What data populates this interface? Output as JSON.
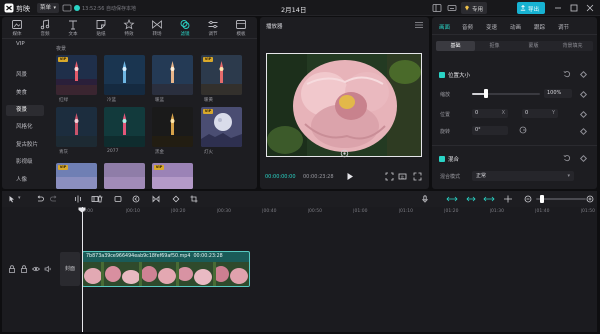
{
  "titlebar": {
    "app_name": "剪映",
    "menu_label": "菜单",
    "autosave_text": "13:52:56 自动保存本地",
    "project_title": "2月14日",
    "pro_label": "专用",
    "export_label": "导出"
  },
  "media_toolbar": {
    "items": [
      {
        "label": "媒体",
        "icon": "media-icon"
      },
      {
        "label": "音频",
        "icon": "audio-icon"
      },
      {
        "label": "文本",
        "icon": "text-icon"
      },
      {
        "label": "贴纸",
        "icon": "sticker-icon"
      },
      {
        "label": "特效",
        "icon": "effects-icon"
      },
      {
        "label": "转场",
        "icon": "transition-icon"
      },
      {
        "label": "滤镜",
        "icon": "filter-icon"
      },
      {
        "label": "调节",
        "icon": "adjust-icon"
      },
      {
        "label": "模板",
        "icon": "template-icon"
      }
    ],
    "active_index": 6
  },
  "categories": {
    "items": [
      "VIP",
      "风景",
      "美食",
      "夜景",
      "风格化",
      "复古胶片",
      "影视级",
      "人像",
      "基础"
    ],
    "active_index": 3
  },
  "filter_section_heading": "夜景",
  "filters": [
    {
      "name": "红绿",
      "vip": true
    },
    {
      "name": "冷蓝",
      "vip": false
    },
    {
      "name": "暖蓝",
      "vip": false
    },
    {
      "name": "暖黄",
      "vip": true
    },
    {
      "name": "青灰",
      "vip": false
    },
    {
      "name": "2077",
      "vip": false
    },
    {
      "name": "黑金",
      "vip": false
    },
    {
      "name": "灯火",
      "vip": false
    },
    {
      "name": "",
      "vip": true
    },
    {
      "name": "",
      "vip": false
    },
    {
      "name": "",
      "vip": true
    }
  ],
  "player": {
    "title": "播放器",
    "timecode_current": "00:00:00:00",
    "timecode_total": "00:00:23:28"
  },
  "inspector": {
    "tabs": [
      "画面",
      "音频",
      "变速",
      "动画",
      "跟踪",
      "调节"
    ],
    "active_tab": 0,
    "subtabs": [
      "基础",
      "抠像",
      "蒙版",
      "背景填充"
    ],
    "active_subtab": 0,
    "position_section": {
      "title": "位置大小",
      "scale_label": "缩放",
      "scale_value": "100%",
      "scale_fraction": 0.21,
      "position_label": "位置",
      "pos_x": "0",
      "pos_x_unit": "X",
      "pos_y": "0",
      "pos_y_unit": "Y",
      "rotate_label": "旋转",
      "rotate_value": "0°"
    },
    "blend_section": {
      "title": "混合",
      "mode_label": "混合模式",
      "mode_value": "正常"
    }
  },
  "timeline": {
    "ruler_labels": [
      "00:00",
      "|00:10",
      "|00:20",
      "|00:30",
      "|00:40",
      "|00:50",
      "|01:00",
      "|01:10",
      "|01:20",
      "|01:30",
      "|01:40",
      "|01:50"
    ],
    "cover_label": "封面",
    "clip_title": "7b873a39ce966494eab9c18fef69af50.mp4",
    "clip_duration": "00:00:23:28",
    "zoom_fraction": 0.12
  },
  "colors": {
    "accent": "#2ad4c6",
    "export_button": "#17b2d2",
    "clip_fill": "#1a5b58",
    "panel": "#1d1d21",
    "background": "#0e0e10"
  }
}
